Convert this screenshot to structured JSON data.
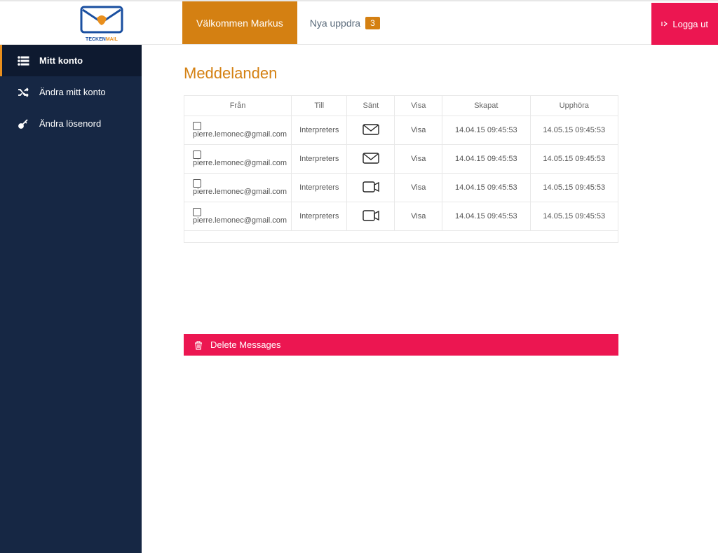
{
  "header": {
    "welcome": "Välkommen Markus",
    "notif_label": "Nya uppdra",
    "notif_count": "3",
    "logout": "Logga ut"
  },
  "logo": {
    "brand": "TECKEN",
    "brand2": "MAIL"
  },
  "sidebar": {
    "items": [
      {
        "label": "Mitt konto",
        "icon": "list",
        "active": true
      },
      {
        "label": "Ändra mitt konto",
        "icon": "shuffle",
        "active": false
      },
      {
        "label": "Ändra lösenord",
        "icon": "key",
        "active": false
      }
    ]
  },
  "page_title": "Meddelanden",
  "columns": {
    "from": "Från",
    "to": "Till",
    "sent": "Sänt",
    "show": "Visa",
    "created": "Skapat",
    "expires": "Upphöra"
  },
  "rows": [
    {
      "from": "pierre.lemonec@gmail.com",
      "to": "Interpreters",
      "type": "mail",
      "show": "Visa",
      "created": "14.04.15  09:45:53",
      "expires": "14.05.15  09:45:53"
    },
    {
      "from": "pierre.lemonec@gmail.com",
      "to": "Interpreters",
      "type": "mail",
      "show": "Visa",
      "created": "14.04.15  09:45:53",
      "expires": "14.05.15  09:45:53"
    },
    {
      "from": "pierre.lemonec@gmail.com",
      "to": "Interpreters",
      "type": "video",
      "show": "Visa",
      "created": "14.04.15  09:45:53",
      "expires": "14.05.15  09:45:53"
    },
    {
      "from": "pierre.lemonec@gmail.com",
      "to": "Interpreters",
      "type": "video",
      "show": "Visa",
      "created": "14.04.15  09:45:53",
      "expires": "14.05.15  09:45:53"
    }
  ],
  "delete_label": "Delete Messages"
}
